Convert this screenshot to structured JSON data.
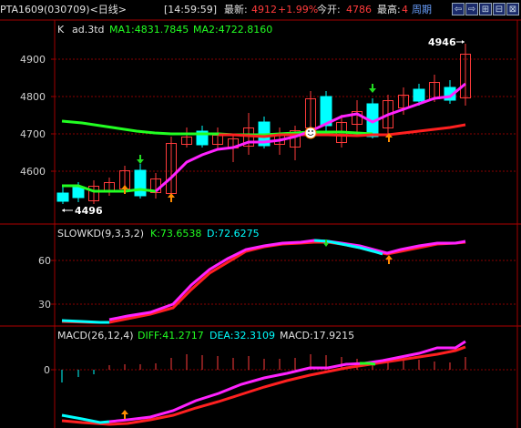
{
  "header": {
    "symbol_title": "PTA1609(030709)<日线>",
    "time": "[14:59:59]",
    "latest_label": "最新:",
    "latest_value": "4912",
    "change_pct": "+1.99%",
    "open_label": "今开:",
    "open_value": "4786",
    "high_label": "最高:",
    "high_value": "4",
    "period_label": "周期",
    "nav_buttons": [
      "⇦",
      "⇨",
      "⊞",
      "⊟",
      "⊠"
    ]
  },
  "main_panel": {
    "legend_k": "K",
    "legend_ad": "ad.3td",
    "ma1_label": "MA1:4831.7845",
    "ma2_label": "MA2:4722.8160",
    "high_mark": "4946",
    "low_mark": "4496",
    "y_ticks": [
      "4900",
      "4800",
      "4700",
      "4600"
    ]
  },
  "kd_panel": {
    "title": "SLOWKD(9,3,3,2)",
    "k_label": "K:73.6538",
    "d_label": "D:72.6275",
    "y_ticks": [
      "60",
      "30"
    ]
  },
  "macd_panel": {
    "title": "MACD(26,12,4)",
    "diff_label": "DIFF:41.2717",
    "dea_label": "DEA:32.3109",
    "macd_label": "MACD:17.9215",
    "y_ticks": [
      "0"
    ]
  },
  "colors": {
    "up": "#ff3b3b",
    "down": "#00ffff",
    "ma1": "#ff22ff",
    "ma2": "#ff2020",
    "green_line": "#22ff22",
    "axis": "#a00000",
    "grid": "#8a0000"
  }
}
